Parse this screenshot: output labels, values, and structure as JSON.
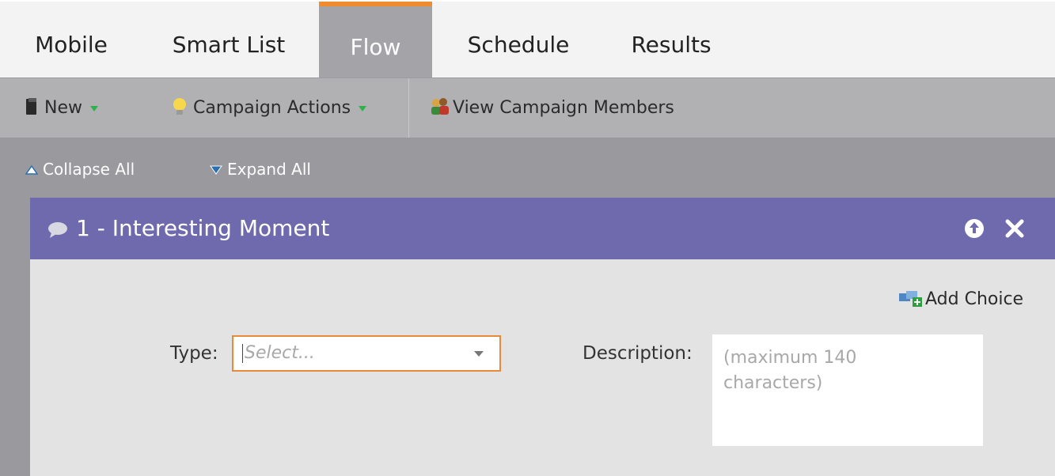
{
  "tabs": [
    {
      "label": "Mobile",
      "active": false
    },
    {
      "label": "Smart List",
      "active": false
    },
    {
      "label": "Flow",
      "active": true
    },
    {
      "label": "Schedule",
      "active": false
    },
    {
      "label": "Results",
      "active": false
    }
  ],
  "toolbar": {
    "new_label": "New",
    "campaign_actions_label": "Campaign Actions",
    "view_members_label": "View Campaign Members"
  },
  "subbar": {
    "collapse_label": "Collapse All",
    "expand_label": "Expand All"
  },
  "step": {
    "title": "1 - Interesting Moment",
    "add_choice_label": "Add Choice",
    "type_label": "Type:",
    "type_placeholder": "Select...",
    "description_label": "Description:",
    "description_placeholder": "(maximum 140 characters)"
  },
  "colors": {
    "active_tab_accent": "#f08c2e",
    "step_header": "#6e6aad",
    "dropdown_arrow": "#2db14a"
  }
}
